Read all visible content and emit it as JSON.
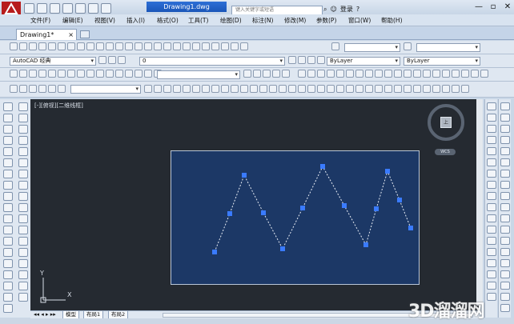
{
  "titlebar": {
    "document_title": "Drawing1.dwg",
    "search_placeholder": "键入关键字或短语",
    "login_label": "登录",
    "minimize": "—",
    "restore": "▫",
    "close": "✕"
  },
  "menubar": {
    "items": [
      "文件(F)",
      "编辑(E)",
      "视图(V)",
      "插入(I)",
      "格式(O)",
      "工具(T)",
      "绘图(D)",
      "标注(N)",
      "修改(M)",
      "参数(P)",
      "窗口(W)",
      "帮助(H)"
    ]
  },
  "tabs": {
    "file_tab": "Drawing1*",
    "close": "×"
  },
  "toolbar": {
    "workspace": "AutoCAD 经典",
    "layer_value": "0",
    "color_value": "ByLayer",
    "linetype_value": "ByLayer"
  },
  "viewport": {
    "label": "[-][俯视][二维线框]",
    "viewcube_label": "上",
    "wcs_label": "WCS",
    "ucs_y": "Y",
    "ucs_x": "X"
  },
  "drawing": {
    "line_color": "#e8edf5",
    "grip_color": "#3a7bff",
    "rect_color": "#1c3866"
  },
  "layout_tabs": [
    "模型",
    "布局1",
    "布局2"
  ],
  "watermark": "3D溜溜网"
}
